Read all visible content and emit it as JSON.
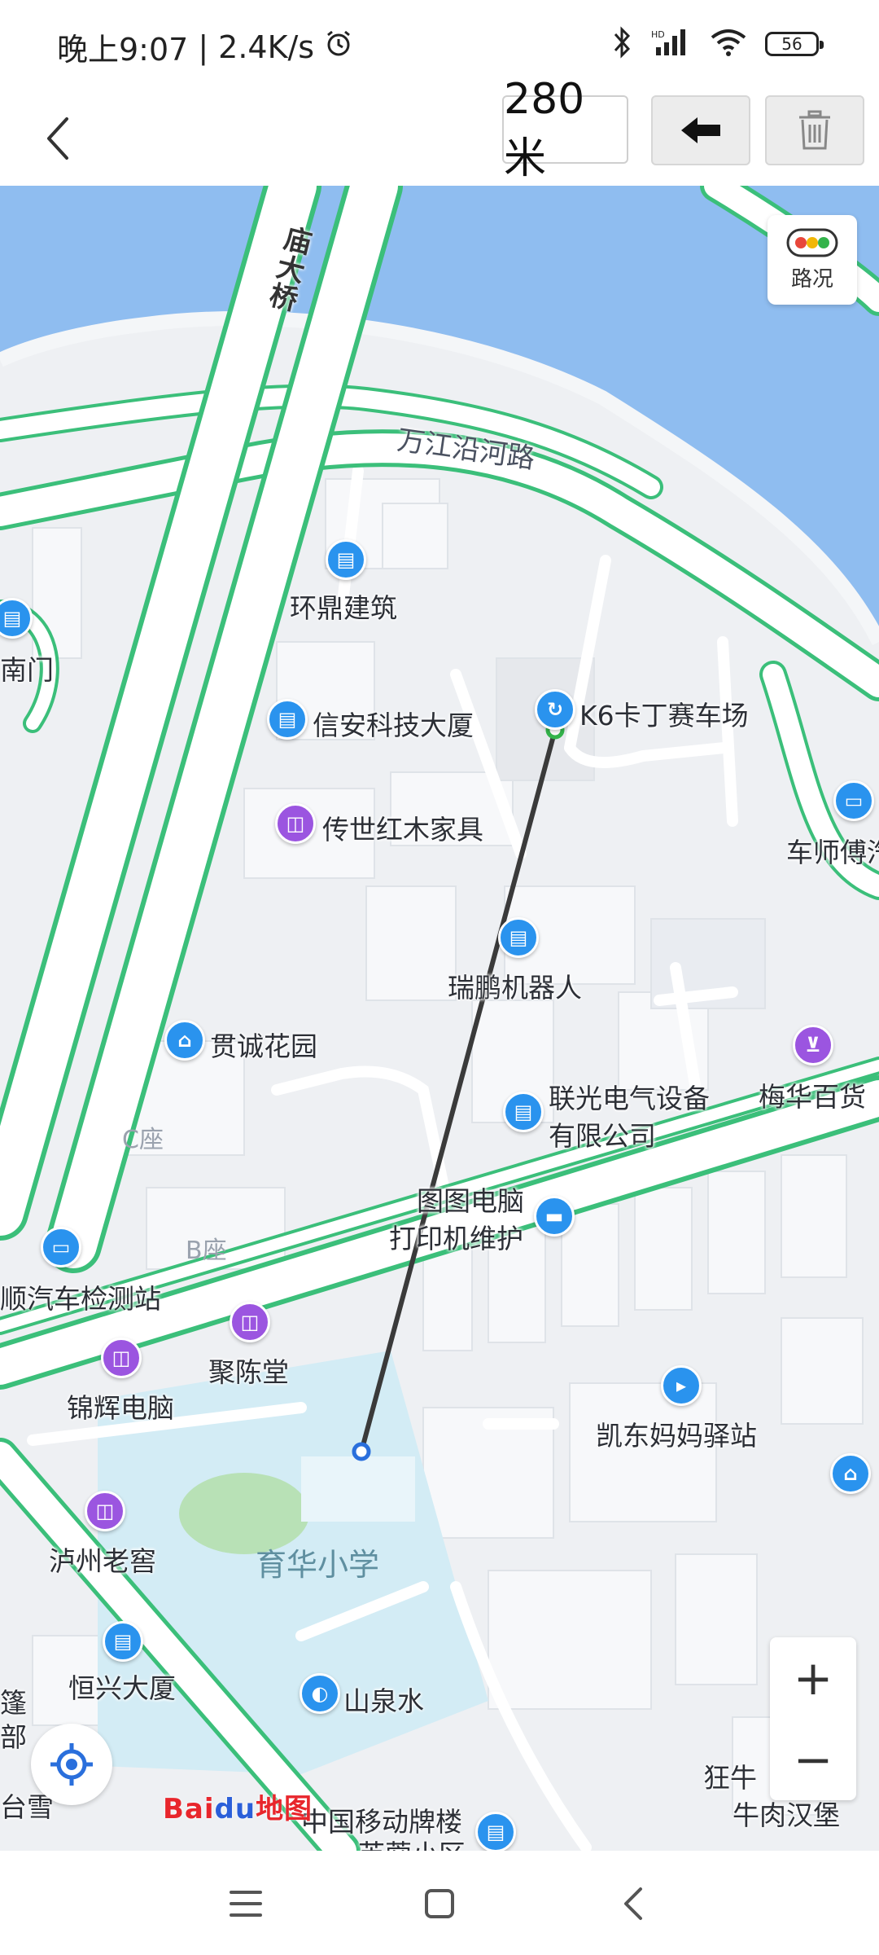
{
  "status_bar": {
    "time": "晚上9:07",
    "separator": "|",
    "net_speed": "2.4K/s",
    "battery": "56",
    "icons": [
      "alarm-icon",
      "bluetooth-icon",
      "signal-icon",
      "wifi-icon",
      "battery-icon"
    ]
  },
  "toolbar": {
    "distance": "280米",
    "icons": [
      "back-chevron-icon",
      "undo-arrow-icon",
      "trash-icon"
    ]
  },
  "map": {
    "traffic_label": "路况",
    "roads": {
      "wanjiang_road": "万江沿河路",
      "bridge": "庙大桥"
    },
    "pois": {
      "huanding": "环鼎建筑",
      "xinan": "信安科技大厦",
      "k6": "K6卡丁赛车场",
      "chuanshi": "传世红木家具",
      "cheshi": "车师傅汽",
      "ruipeng": "瑞鹏机器人",
      "guancheng": "贯诚花园",
      "lianguang_1": "联光电气设备",
      "lianguang_2": "有限公司",
      "meihua": "梅华百货",
      "tutu_1": "图图电脑",
      "tutu_2": "打印机维护",
      "shun": "顺汽车检测站",
      "juchen": "聚陈堂",
      "jinhui": "锦辉电脑",
      "kaidong": "凯东妈妈驿站",
      "luzhou": "泸州老窖",
      "hengxing": "恒兴大厦",
      "shanquan": "山泉水",
      "china_mobile": "中国移动牌楼",
      "kuangniu_1": "狂牛",
      "kuangniu_2": "牛肉汉堡",
      "nanmen": "南门",
      "left_cut_1": "篷",
      "left_cut_2": "部",
      "left_cut_3": "台雪",
      "bottom_cut": "芙蓉小区"
    },
    "zones": {
      "c_block": "C座",
      "b_block": "B座"
    },
    "school": "育华小学",
    "zoom_in": "+",
    "zoom_out": "−",
    "logo": {
      "bai": "Bai",
      "du": "du",
      "ditu": "地图"
    },
    "colors": {
      "water": "#8fbdf0",
      "road_green": "#3bbf7a",
      "measure_line": "#3a3a3a",
      "start_marker": "#2a6fdc",
      "end_marker": "#33b34a"
    }
  },
  "nav_bar": {
    "icons": [
      "menu-icon",
      "home-square-icon",
      "back-triangle-icon"
    ]
  }
}
